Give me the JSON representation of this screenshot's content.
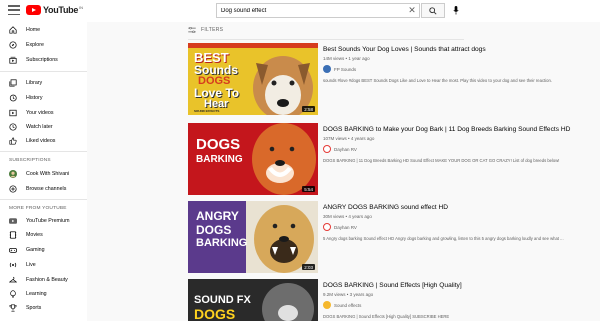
{
  "header": {
    "logo_text": "YouTube",
    "logo_country": "IN",
    "search_value": "Dog sound effect",
    "search_placeholder": "Search",
    "clear_symbol": "✕"
  },
  "sidebar": {
    "main": [
      {
        "label": "Home",
        "icon": "home-icon"
      },
      {
        "label": "Explore",
        "icon": "compass-icon"
      },
      {
        "label": "Subscriptions",
        "icon": "subscriptions-icon"
      }
    ],
    "library": [
      {
        "label": "Library",
        "icon": "library-icon"
      },
      {
        "label": "History",
        "icon": "history-icon"
      },
      {
        "label": "Your videos",
        "icon": "play-square-icon"
      },
      {
        "label": "Watch later",
        "icon": "clock-icon"
      },
      {
        "label": "Liked videos",
        "icon": "thumbs-up-icon"
      }
    ],
    "subscriptions_heading": "SUBSCRIPTIONS",
    "subscriptions": [
      {
        "label": "Cook With Shivani",
        "icon": "avatar"
      },
      {
        "label": "Browse channels",
        "icon": "plus-circle-icon"
      }
    ],
    "more_heading": "MORE FROM YOUTUBE",
    "more": [
      {
        "label": "YouTube Premium",
        "icon": "youtube-icon"
      },
      {
        "label": "Movies",
        "icon": "film-icon"
      },
      {
        "label": "Gaming",
        "icon": "gamepad-icon"
      },
      {
        "label": "Live",
        "icon": "live-icon"
      },
      {
        "label": "Fashion & Beauty",
        "icon": "hanger-icon"
      },
      {
        "label": "Learning",
        "icon": "bulb-icon"
      },
      {
        "label": "Sports",
        "icon": "trophy-icon"
      }
    ]
  },
  "filters_label": "FILTERS",
  "videos": [
    {
      "title": "Best Sounds Your Dog Loves | Sounds that attract dogs",
      "meta": "14M views • 1 year ago",
      "channel": "FP Sounds",
      "description": "sounds #love #dogs BEST Sounds Dogs Like and Love to Hear the most. Play this video to your dog and see their reaction.",
      "duration": "2:58",
      "thumb_lines": [
        "BEST",
        "Sounds",
        "DOGS",
        "Love To",
        "Hear",
        "SOUND EFFECTS"
      ]
    },
    {
      "title": "DOGS BARKING to Make your Dog Bark | 11 Dog Breeds Barking Sound Effects HD",
      "meta": "107M views • 4 years ago",
      "channel": "Dayhan RV",
      "description": "DOGS BARKING | 11 Dog Breeds Barking HD Sound Effect MAKE YOUR DOG OR CAT GO CRAZY! List of dog breeds below!",
      "duration": "5:54",
      "thumb_lines": [
        "DOGS",
        "BARKING"
      ]
    },
    {
      "title": "ANGRY DOGS BARKING sound effect HD",
      "meta": "30M views • 4 years ago",
      "channel": "Dayhan RV",
      "description": "5 Angry dogs barking Sound effect HD Angry dogs barking and growling, listen to this 5 angry dogs barking loudly and see what ...",
      "duration": "2:03",
      "thumb_lines": [
        "ANGRY",
        "DOGS",
        "BARKING"
      ]
    },
    {
      "title": "DOGS BARKING | Sound Effects [High Quality]",
      "meta": "9.2M views • 3 years ago",
      "channel": "Sound effects",
      "description": "DOGS BARKING | Sound Effects [High Quality] SUBSCRIBE HERE",
      "duration": "",
      "thumb_lines": [
        "SOUND FX",
        "DOGS"
      ]
    }
  ],
  "colors": {
    "brand_red": "#ff0000",
    "thumb1_bg": "#e9c32a",
    "thumb2_bg": "#c4161c",
    "thumb3_bg": "#5b3a8c",
    "thumb4_bg": "#2a2a2a"
  }
}
